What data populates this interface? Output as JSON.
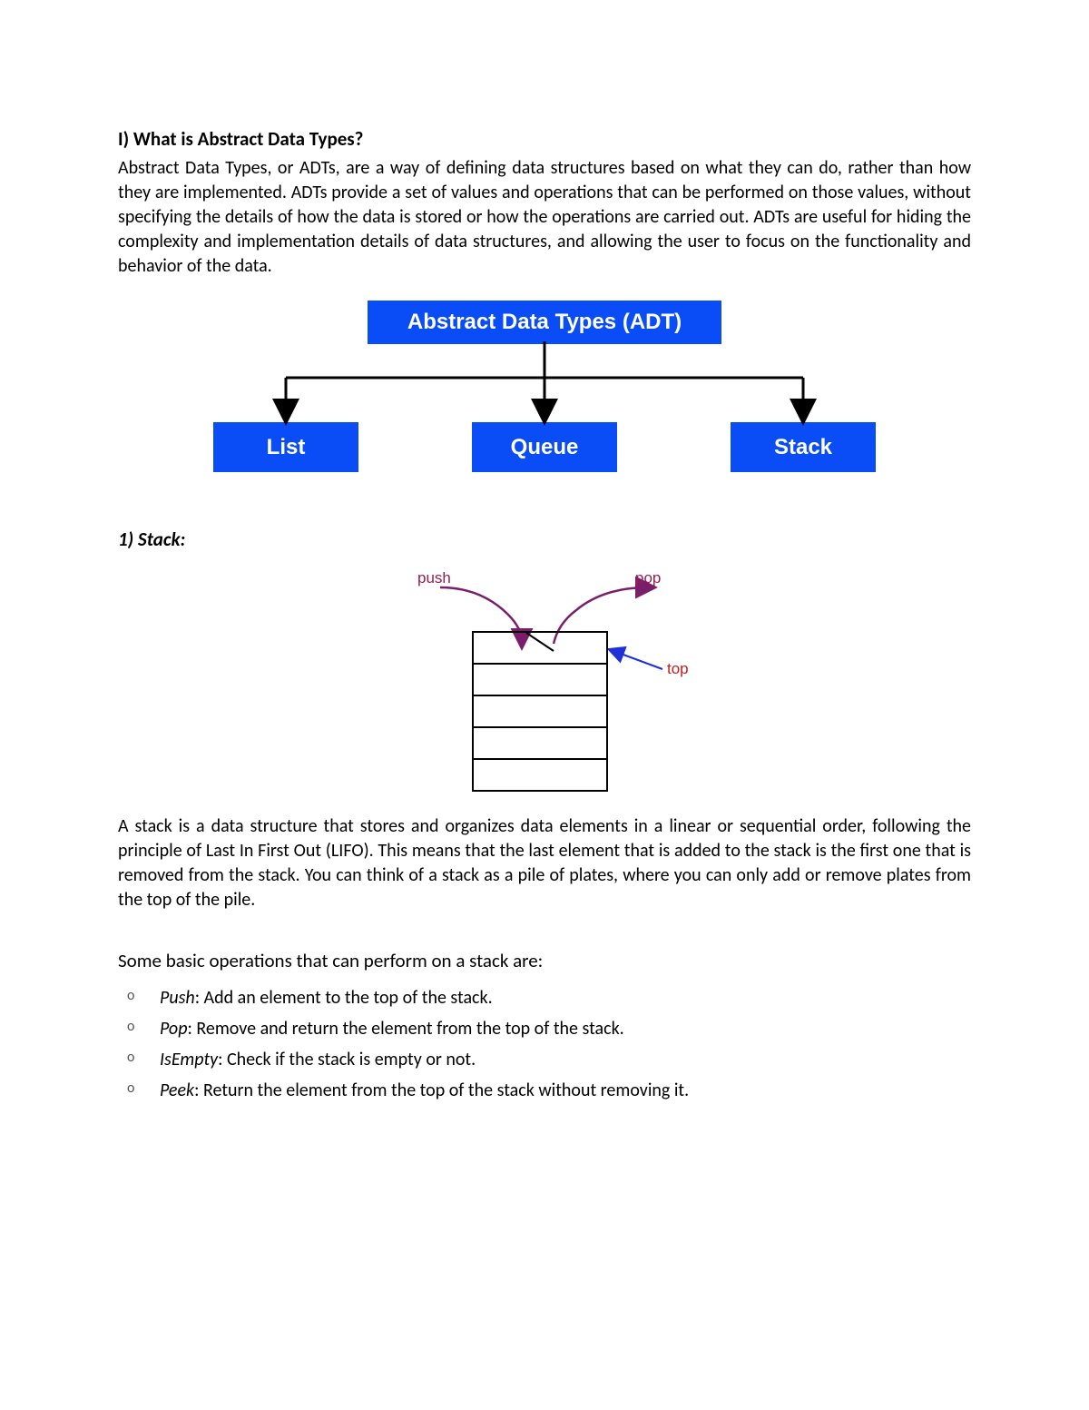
{
  "section1": {
    "heading": "I) What is Abstract Data Types?",
    "paragraph": "Abstract Data Types, or ADTs, are a way of defining data structures based on what they can do, rather than how they are implemented. ADTs provide a set of values and operations that can be performed on those values, without specifying the details of how the data is stored or how the operations are carried out. ADTs are useful for hiding the complexity and implementation details of data structures, and allowing the user to focus on the functionality and behavior of the data."
  },
  "diagram_adt": {
    "root": "Abstract Data Types (ADT)",
    "children": [
      "List",
      "Queue",
      "Stack"
    ]
  },
  "stack": {
    "heading": "1) Stack:",
    "labels": {
      "push": "push",
      "pop": "pop",
      "top": "top"
    },
    "paragraph": "A stack is a data structure that stores and organizes data elements in a linear or sequential order, following the principle of Last In First Out (LIFO). This means that the last element that is added to the stack is the first one that is removed from the stack. You can think of a stack as a pile of plates, where you can only add or remove plates from the top of the pile.",
    "ops_intro": "Some basic operations that can perform on a stack are:",
    "ops": [
      {
        "name": "Push",
        "desc": ": Add an element to the top of the stack."
      },
      {
        "name": "Pop",
        "desc": ": Remove and return the element from the top of the stack."
      },
      {
        "name": "IsEmpty",
        "desc": ": Check if the stack is empty or not."
      },
      {
        "name": "Peek",
        "desc": ": Return the element from the top of the stack without removing it."
      }
    ]
  }
}
